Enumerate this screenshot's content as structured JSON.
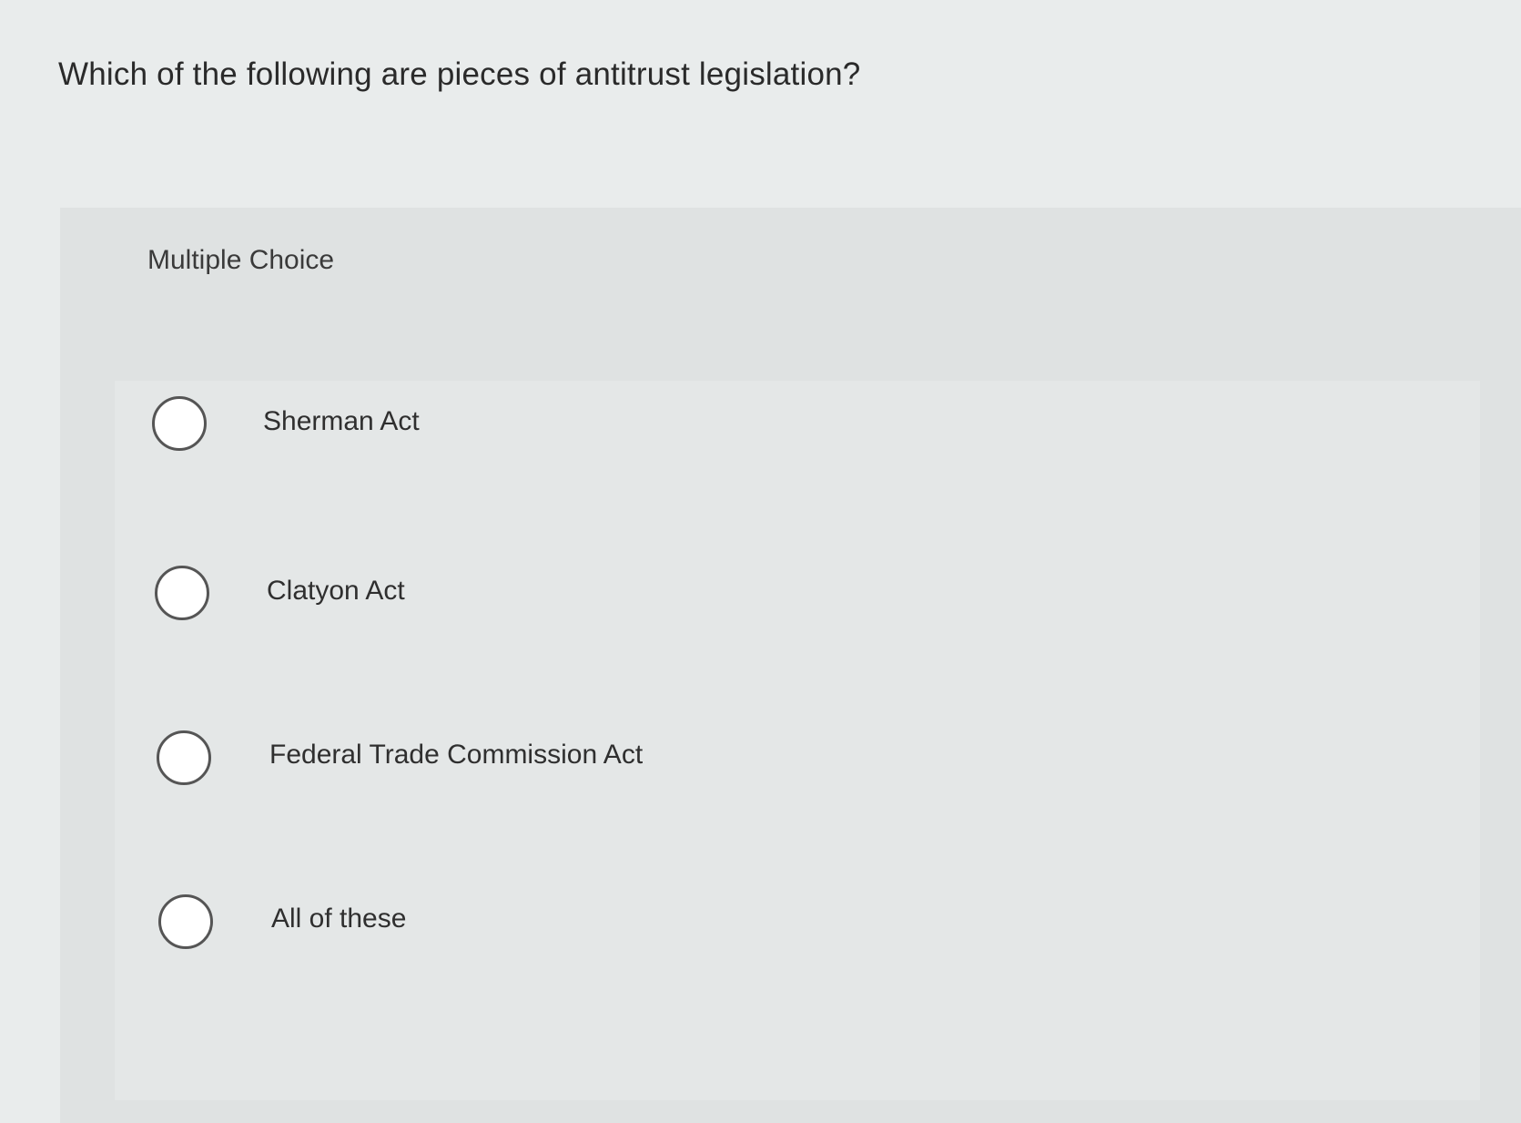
{
  "question": {
    "text": "Which of the following are pieces of antitrust legislation?"
  },
  "card": {
    "label": "Multiple Choice"
  },
  "options": [
    {
      "label": "Sherman Act",
      "selected": false
    },
    {
      "label": "Clatyon Act",
      "selected": false
    },
    {
      "label": "Federal Trade Commission Act",
      "selected": false
    },
    {
      "label": "All of these",
      "selected": false
    }
  ]
}
